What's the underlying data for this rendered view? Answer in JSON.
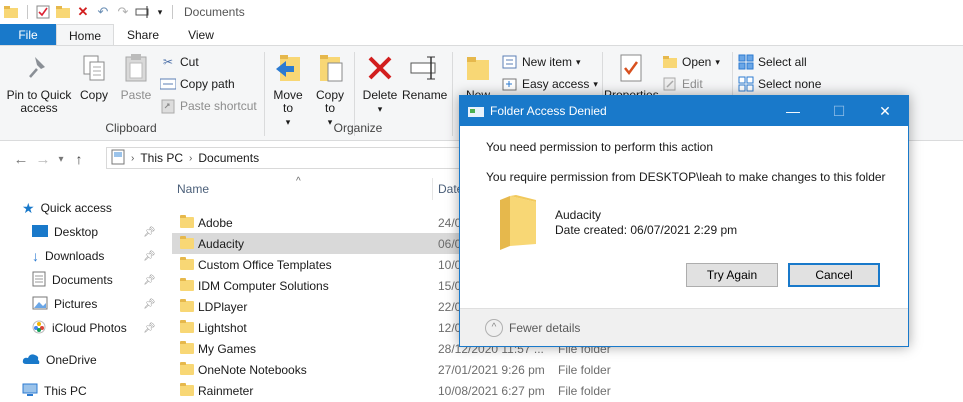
{
  "window": {
    "title": "Documents"
  },
  "tabs": [
    {
      "label": "File"
    },
    {
      "label": "Home"
    },
    {
      "label": "Share"
    },
    {
      "label": "View"
    }
  ],
  "ribbon": {
    "clipboard": {
      "pin_label": "Pin to Quick access",
      "copy_label": "Copy",
      "paste_label": "Paste",
      "cut_label": "Cut",
      "copy_path_label": "Copy path",
      "paste_shortcut_label": "Paste shortcut",
      "group_label": "Clipboard"
    },
    "organize": {
      "move_to_label": "Move to",
      "copy_to_label": "Copy to",
      "delete_label": "Delete",
      "rename_label": "Rename",
      "group_label": "Organize"
    },
    "new": {
      "new_folder_label": "New",
      "new_item_label": "New item",
      "easy_access_label": "Easy access"
    },
    "open": {
      "properties_label": "Properties",
      "open_label": "Open",
      "edit_label": "Edit"
    },
    "select": {
      "select_all_label": "Select all",
      "select_none_label": "Select none"
    }
  },
  "address": {
    "crumbs": [
      "This PC",
      "Documents"
    ]
  },
  "navpane": {
    "items": [
      {
        "label": "Quick access"
      },
      {
        "label": "Desktop"
      },
      {
        "label": "Downloads"
      },
      {
        "label": "Documents"
      },
      {
        "label": "Pictures"
      },
      {
        "label": "iCloud Photos"
      },
      {
        "label": "OneDrive"
      },
      {
        "label": "This PC"
      }
    ]
  },
  "filelist": {
    "col_name": "Name",
    "col_date": "Date",
    "rows": [
      {
        "name": "Adobe",
        "date": "24/0",
        "type": ""
      },
      {
        "name": "Audacity",
        "date": "06/0",
        "type": ""
      },
      {
        "name": "Custom Office Templates",
        "date": "10/0",
        "type": ""
      },
      {
        "name": "IDM Computer Solutions",
        "date": "15/0",
        "type": ""
      },
      {
        "name": "LDPlayer",
        "date": "22/0",
        "type": ""
      },
      {
        "name": "Lightshot",
        "date": "12/0",
        "type": ""
      },
      {
        "name": "My Games",
        "date": "28/12/2020 11:57 ...",
        "type": "File folder"
      },
      {
        "name": "OneNote Notebooks",
        "date": "27/01/2021 9:26 pm",
        "type": "File folder"
      },
      {
        "name": "Rainmeter",
        "date": "10/08/2021 6:27 pm",
        "type": "File folder"
      }
    ]
  },
  "dialog": {
    "title": "Folder Access Denied",
    "message1": "You need permission to perform this action",
    "message2": "You require permission from DESKTOP\\leah to make changes to this folder",
    "item_name": "Audacity",
    "item_date": "Date created: 06/07/2021 2:29 pm",
    "try_again_label": "Try Again",
    "cancel_label": "Cancel",
    "fewer_details_label": "Fewer details"
  },
  "colors": {
    "accent": "#1979ca",
    "folder": "#f8d775",
    "selection": "#d9d9d9"
  }
}
